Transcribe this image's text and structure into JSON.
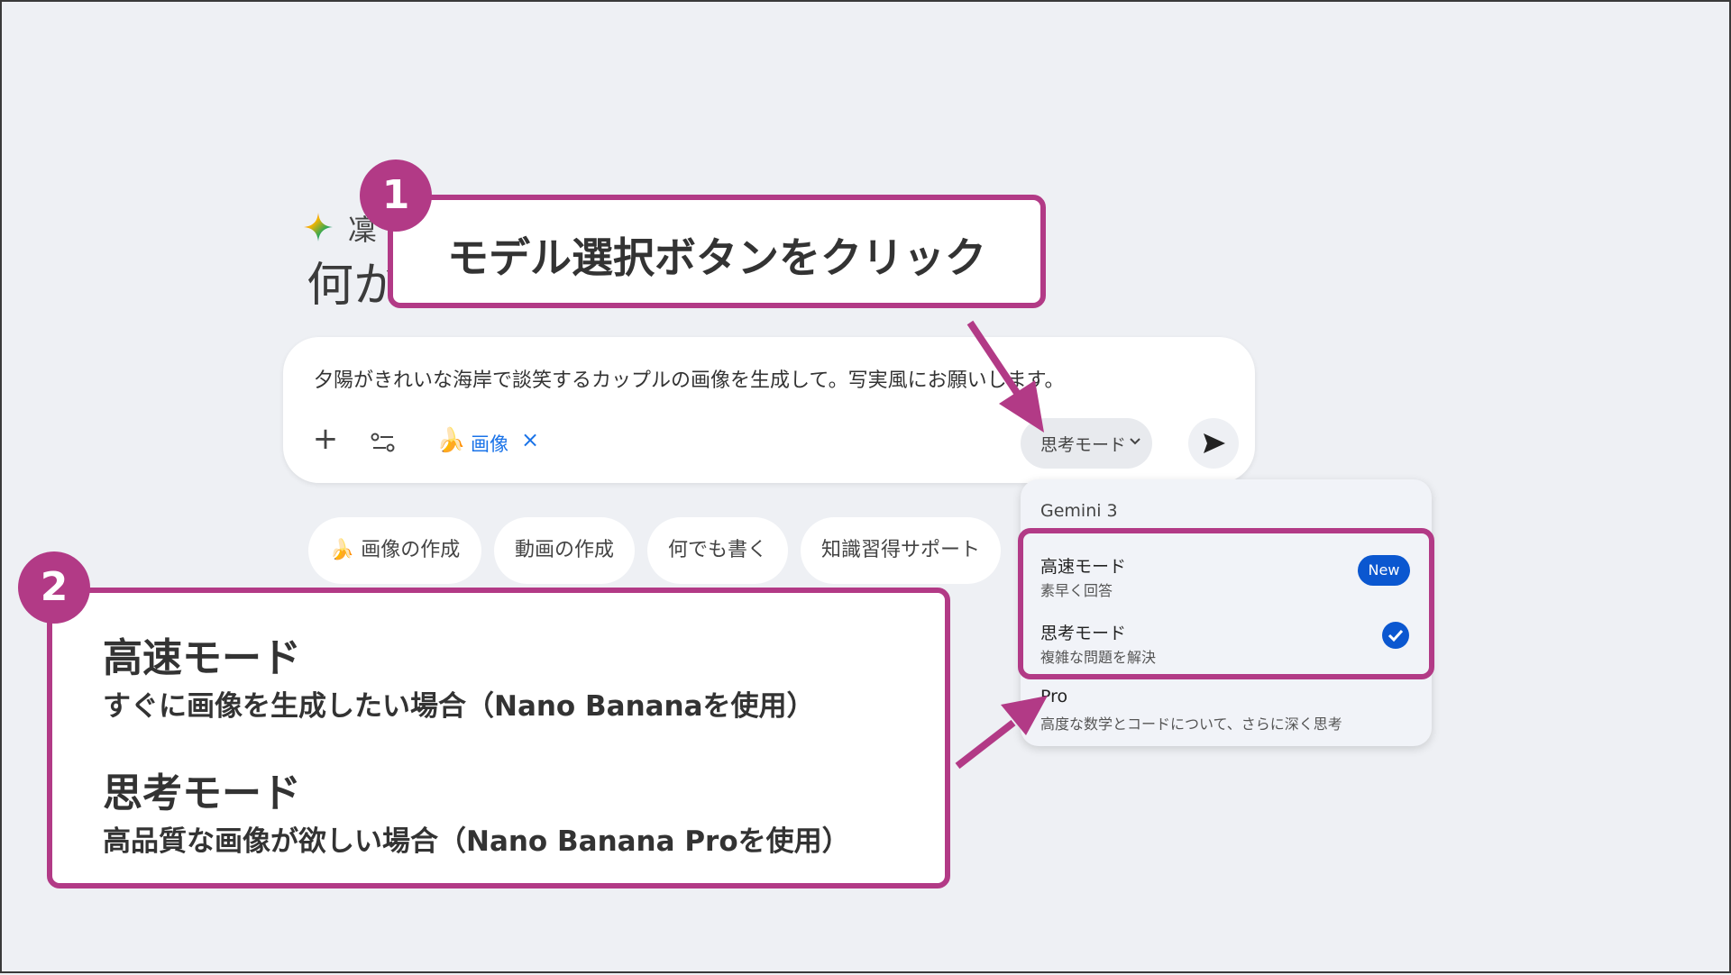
{
  "greeting": {
    "name": "凜",
    "question": "何か"
  },
  "input": {
    "prompt": "夕陽がきれいな海岸で談笑するカップルの画像を生成して。写実風にお願いします。",
    "add_icon": "plus-icon",
    "tools_icon": "tune-icon",
    "image_chip_label": "画像",
    "image_chip_close": "×",
    "mode_button_label": "思考モード",
    "send_icon": "send-icon"
  },
  "suggestions": [
    "画像の作成",
    "動画の作成",
    "何でも書く",
    "知識習得サポート"
  ],
  "dropdown": {
    "header": "Gemini 3",
    "items": [
      {
        "title": "高速モード",
        "subtitle": "素早く回答",
        "badge": "New"
      },
      {
        "title": "思考モード",
        "subtitle": "複雑な問題を解決",
        "selected": true
      },
      {
        "title": "Pro",
        "subtitle": "高度な数学とコードについて、さらに深く思考"
      }
    ]
  },
  "callout1": {
    "number": "1",
    "text": "モデル選択ボタンをクリック"
  },
  "callout2": {
    "number": "2",
    "fast_title": "高速モード",
    "fast_desc": "すぐに画像を生成したい場合（Nano Bananaを使用）",
    "think_title": "思考モード",
    "think_desc": "高品質な画像が欲しい場合（Nano Banana Proを使用）"
  },
  "colors": {
    "accent": "#b23a86",
    "primary_blue": "#0b57d0",
    "link_blue": "#1a73e8",
    "background": "#eef0f4"
  }
}
